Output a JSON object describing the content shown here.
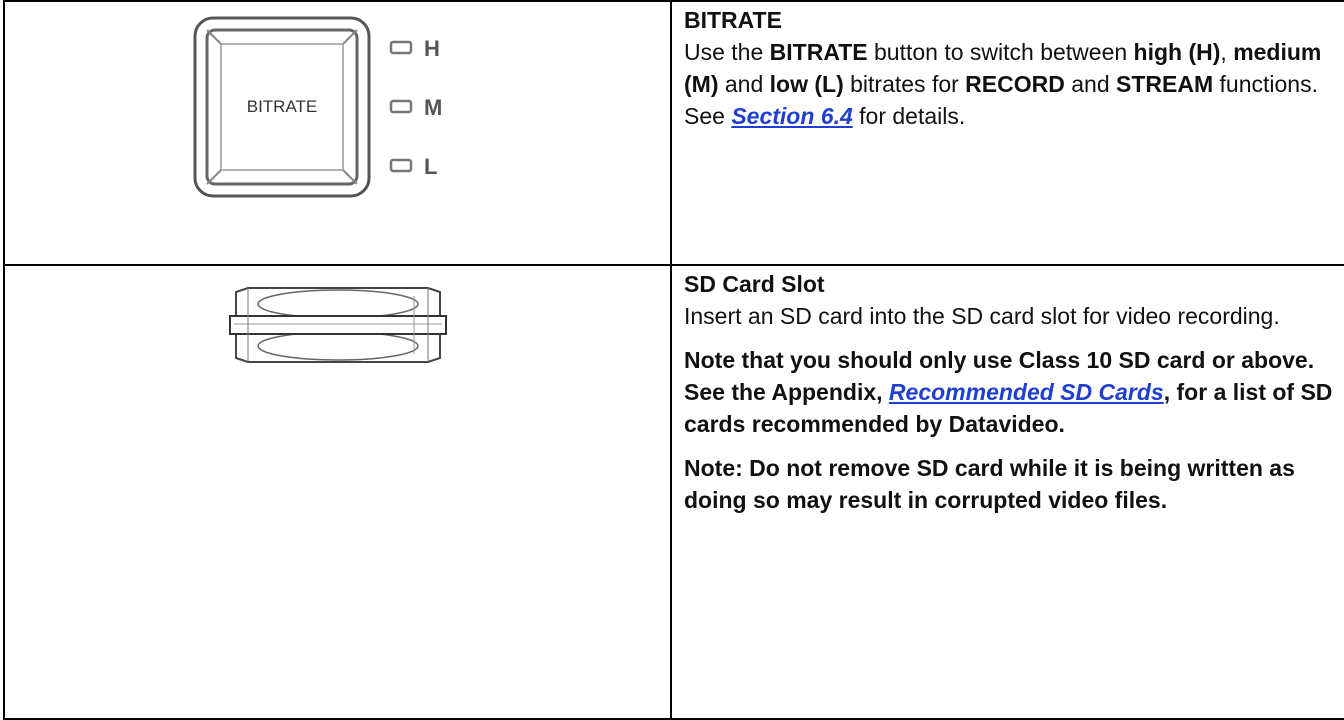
{
  "bitrate": {
    "button_label": "BITRATE",
    "indicators": [
      "H",
      "M",
      "L"
    ],
    "title": "BITRATE",
    "desc_1": "Use the ",
    "desc_button": "BITRATE",
    "desc_2": " button to switch between ",
    "desc_high": "high (H)",
    "desc_3": ", ",
    "desc_medium": "medium (M)",
    "desc_4": " and ",
    "desc_low": "low (L)",
    "desc_5": " bitrates for ",
    "desc_record": "RECORD",
    "desc_6": " and ",
    "desc_stream": "STREAM",
    "desc_7": " functions. See ",
    "desc_link": "Section 6.4",
    "desc_8": " for details."
  },
  "sd": {
    "title": "SD Card Slot",
    "desc": "Insert an SD card into the SD card slot for video recording.",
    "note1_a": "Note that you should only use Class 10 SD card or above. See the Appendix, ",
    "note1_link": "Recommended SD Cards",
    "note1_b": ", for a list of SD cards recommended by Datavideo.",
    "note2": "Note: Do not remove SD card while it is being written as doing so may result in corrupted video files."
  },
  "colors": {
    "link": "#1f3fd0",
    "border": "#000000"
  }
}
